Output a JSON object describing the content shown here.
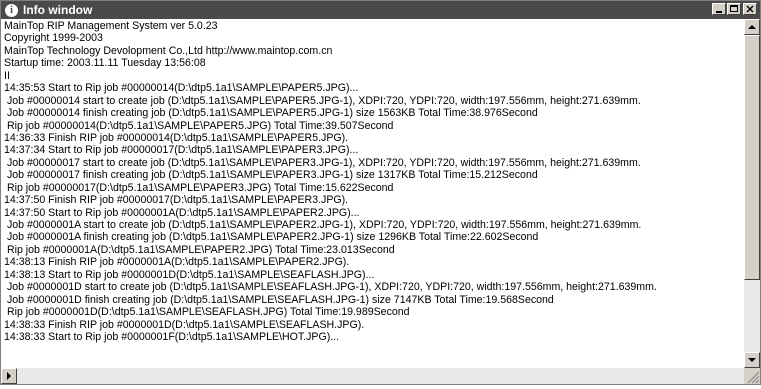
{
  "window": {
    "title": "Info window",
    "title_icon": "info-icon"
  },
  "log_lines": [
    "MainTop RIP Management System ver 5.0.23",
    "Copyright 1999-2003",
    "MainTop Technology Devolopment Co.,Ltd http://www.maintop.com.cn",
    "Startup time: 2003.11.11 Tuesday 13:56:08",
    "II",
    "14:35:53 Start to Rip job #00000014(D:\\dtp5.1a1\\SAMPLE\\PAPER5.JPG)...",
    " Job #00000014 start to create job (D:\\dtp5.1a1\\SAMPLE\\PAPER5.JPG-1), XDPI:720, YDPI:720, width:197.556mm, height:271.639mm.",
    " Job #00000014 finish creating job (D:\\dtp5.1a1\\SAMPLE\\PAPER5.JPG-1) size 1563KB Total Time:38.976Second",
    " Rip job #00000014(D:\\dtp5.1a1\\SAMPLE\\PAPER5.JPG) Total Time:39.507Second",
    "14:36:33 Finish RIP job #00000014(D:\\dtp5.1a1\\SAMPLE\\PAPER5.JPG).",
    "14:37:34 Start to Rip job #00000017(D:\\dtp5.1a1\\SAMPLE\\PAPER3.JPG)...",
    " Job #00000017 start to create job (D:\\dtp5.1a1\\SAMPLE\\PAPER3.JPG-1), XDPI:720, YDPI:720, width:197.556mm, height:271.639mm.",
    " Job #00000017 finish creating job (D:\\dtp5.1a1\\SAMPLE\\PAPER3.JPG-1) size 1317KB Total Time:15.212Second",
    " Rip job #00000017(D:\\dtp5.1a1\\SAMPLE\\PAPER3.JPG) Total Time:15.622Second",
    "14:37:50 Finish RIP job #00000017(D:\\dtp5.1a1\\SAMPLE\\PAPER3.JPG).",
    "14:37:50 Start to Rip job #0000001A(D:\\dtp5.1a1\\SAMPLE\\PAPER2.JPG)...",
    " Job #0000001A start to create job (D:\\dtp5.1a1\\SAMPLE\\PAPER2.JPG-1), XDPI:720, YDPI:720, width:197.556mm, height:271.639mm.",
    " Job #0000001A finish creating job (D:\\dtp5.1a1\\SAMPLE\\PAPER2.JPG-1) size 1296KB Total Time:22.602Second",
    " Rip job #0000001A(D:\\dtp5.1a1\\SAMPLE\\PAPER2.JPG) Total Time:23.013Second",
    "14:38:13 Finish RIP job #0000001A(D:\\dtp5.1a1\\SAMPLE\\PAPER2.JPG).",
    "14:38:13 Start to Rip job #0000001D(D:\\dtp5.1a1\\SAMPLE\\SEAFLASH.JPG)...",
    " Job #0000001D start to create job (D:\\dtp5.1a1\\SAMPLE\\SEAFLASH.JPG-1), XDPI:720, YDPI:720, width:197.556mm, height:271.639mm.",
    " Job #0000001D finish creating job (D:\\dtp5.1a1\\SAMPLE\\SEAFLASH.JPG-1) size 7147KB Total Time:19.568Second",
    " Rip job #0000001D(D:\\dtp5.1a1\\SAMPLE\\SEAFLASH.JPG) Total Time:19.989Second",
    "14:38:33 Finish RIP job #0000001D(D:\\dtp5.1a1\\SAMPLE\\SEAFLASH.JPG).",
    "14:38:33 Start to Rip job #0000001F(D:\\dtp5.1a1\\SAMPLE\\HOT.JPG)..."
  ],
  "colors": {
    "titlebar": "#4a4a4a",
    "title_text": "#ffffff",
    "background": "#ffffff",
    "button_face": "#d4d0c8"
  },
  "controls": {
    "minimize_icon": "minimize-icon",
    "maximize_icon": "maximize-icon",
    "close_icon": "close-icon"
  }
}
